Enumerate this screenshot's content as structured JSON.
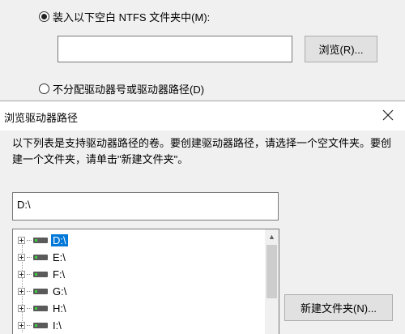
{
  "parent_dialog": {
    "mount_option_label": "装入以下空白 NTFS 文件夹中(M):",
    "folder_path_value": "",
    "browse_button": "浏览(R)...",
    "no_assign_option_label": "不分配驱动器号或驱动器路径(D)"
  },
  "browse_dialog": {
    "title": "浏览驱动器路径",
    "description": "以下列表是支持驱动器路径的卷。要创建驱动器路径，请选择一个空文件夹。要创建一个文件夹，请单击\"新建文件夹\"。",
    "current_path": "D:\\",
    "drives": [
      {
        "label": "D:\\",
        "selected": true
      },
      {
        "label": "E:\\",
        "selected": false
      },
      {
        "label": "F:\\",
        "selected": false
      },
      {
        "label": "G:\\",
        "selected": false
      },
      {
        "label": "H:\\",
        "selected": false
      },
      {
        "label": "I:\\",
        "selected": false
      }
    ],
    "new_folder_button": "新建文件夹(N)..."
  },
  "icons": {
    "close": "close-icon",
    "drive": "drive-icon",
    "expander": "expand-plus-icon",
    "scroll_up": "scroll-up-arrow-icon"
  },
  "colors": {
    "selection": "#0078d7",
    "drive_led": "#3cd13c"
  }
}
